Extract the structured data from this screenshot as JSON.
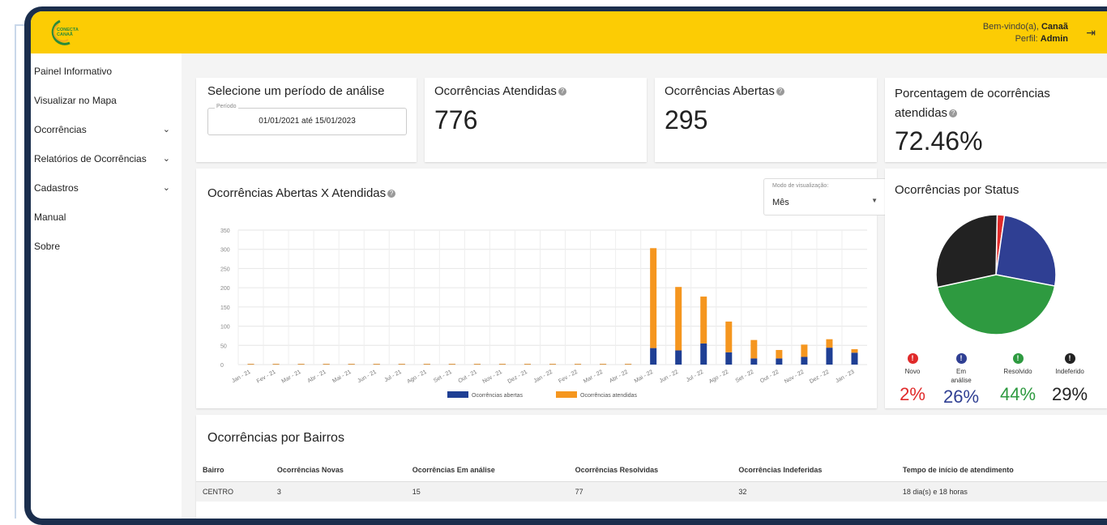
{
  "header": {
    "logo_line1": "CONECTA",
    "logo_line2": "CANAÃ",
    "welcome_prefix": "Bem-vindo(a),",
    "welcome_name": "Canaã",
    "profile_prefix": "Perfil:",
    "profile_name": "Admin",
    "logout_icon": "logout-icon"
  },
  "sidebar": {
    "items": [
      {
        "label": "Painel Informativo",
        "has_chevron": false
      },
      {
        "label": "Visualizar no Mapa",
        "has_chevron": false
      },
      {
        "label": "Ocorrências",
        "has_chevron": true
      },
      {
        "label": "Relatórios de Ocorrências",
        "has_chevron": true
      },
      {
        "label": "Cadastros",
        "has_chevron": true
      },
      {
        "label": "Manual",
        "has_chevron": false
      },
      {
        "label": "Sobre",
        "has_chevron": false
      }
    ]
  },
  "period_card": {
    "title": "Selecione um período de análise",
    "field_label": "Período",
    "field_value": "01/01/2021 até 15/01/2023"
  },
  "kpis": {
    "attended": {
      "title": "Ocorrências Atendidas",
      "value": "776"
    },
    "open": {
      "title": "Ocorrências Abertas",
      "value": "295"
    },
    "percent": {
      "title_line1": "Porcentagem de ocorrências",
      "title_line2": "atendidas",
      "value": "72.46%"
    }
  },
  "chart_card": {
    "title": "Ocorrências Abertas X Atendidas",
    "mode_label": "Modo de visualização:",
    "mode_value": "Mês"
  },
  "chart_data": {
    "type": "bar",
    "stacked": true,
    "categories": [
      "Jan - 21",
      "Fev - 21",
      "Mar - 21",
      "Abr - 21",
      "Mai - 21",
      "Jun - 21",
      "Jul - 21",
      "Ago - 21",
      "Set - 21",
      "Out - 21",
      "Nov - 21",
      "Dez - 21",
      "Jan - 22",
      "Fev - 22",
      "Mar - 22",
      "Abr - 22",
      "Mai - 22",
      "Jun - 22",
      "Jul - 22",
      "Ago - 22",
      "Set - 22",
      "Out - 22",
      "Nov - 22",
      "Dez - 22",
      "Jan - 23"
    ],
    "series": [
      {
        "name": "Ocorrências abertas",
        "color": "#1f3f94",
        "values": [
          0,
          0,
          0,
          0,
          0,
          0,
          0,
          0,
          0,
          0,
          0,
          0,
          0,
          0,
          0,
          0,
          43,
          37,
          55,
          32,
          16,
          16,
          20,
          44,
          31
        ]
      },
      {
        "name": "Ocorrências atendidas",
        "color": "#f5961f",
        "values": [
          0,
          0,
          0,
          0,
          0,
          0,
          0,
          0,
          0,
          0,
          0,
          0,
          0,
          0,
          0,
          0,
          260,
          165,
          122,
          80,
          48,
          22,
          32,
          22,
          9
        ]
      }
    ],
    "yticks": [
      0,
      50,
      100,
      150,
      200,
      250,
      300,
      350
    ],
    "ylim": [
      0,
      350
    ],
    "grid": true,
    "legend_position": "bottom"
  },
  "status_card": {
    "title": "Ocorrências por Status",
    "items": [
      {
        "label": "Novo",
        "percent": "2%",
        "value": 2,
        "color": "#e02a2a",
        "icon": "alert-icon"
      },
      {
        "label": "Em análise",
        "percent": "26%",
        "value": 26,
        "color": "#2f3f93",
        "icon": "alert-icon"
      },
      {
        "label": "Resolvido",
        "percent": "44%",
        "value": 44,
        "color": "#2e9a40",
        "icon": "alert-icon"
      },
      {
        "label": "Indeferido",
        "percent": "29%",
        "value": 29,
        "color": "#222222",
        "icon": "alert-icon"
      }
    ]
  },
  "bairros": {
    "title": "Ocorrências por Bairros",
    "columns": [
      "Bairro",
      "Ocorrências Novas",
      "Ocorrências Em análise",
      "Ocorrências Resolvidas",
      "Ocorrências Indeferidas",
      "Tempo de início de atendimento"
    ],
    "rows": [
      [
        "CENTRO",
        "3",
        "15",
        "77",
        "32",
        "18 dia(s) e 18 horas"
      ]
    ]
  }
}
